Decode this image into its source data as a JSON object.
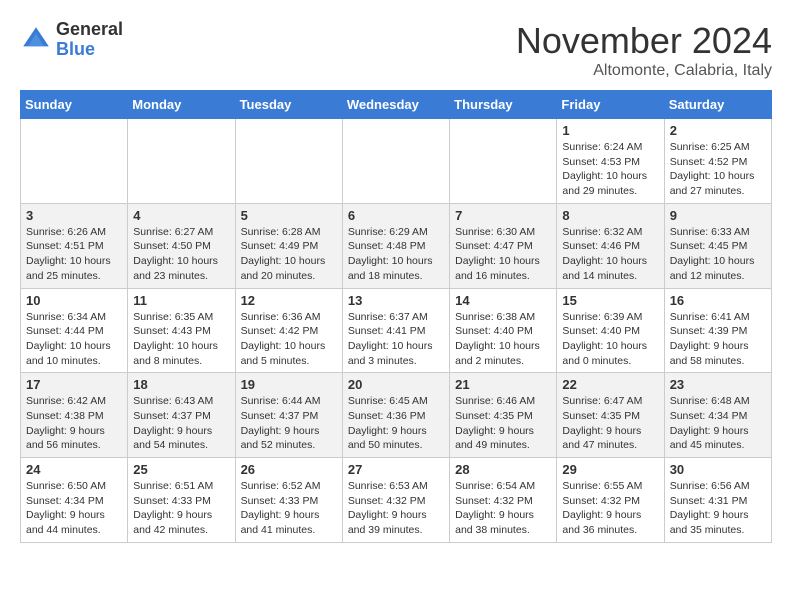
{
  "header": {
    "logo": {
      "line1": "General",
      "line2": "Blue"
    },
    "title": "November 2024",
    "subtitle": "Altomonte, Calabria, Italy"
  },
  "days_of_week": [
    "Sunday",
    "Monday",
    "Tuesday",
    "Wednesday",
    "Thursday",
    "Friday",
    "Saturday"
  ],
  "weeks": [
    [
      {
        "day": "",
        "info": ""
      },
      {
        "day": "",
        "info": ""
      },
      {
        "day": "",
        "info": ""
      },
      {
        "day": "",
        "info": ""
      },
      {
        "day": "",
        "info": ""
      },
      {
        "day": "1",
        "info": "Sunrise: 6:24 AM\nSunset: 4:53 PM\nDaylight: 10 hours and 29 minutes."
      },
      {
        "day": "2",
        "info": "Sunrise: 6:25 AM\nSunset: 4:52 PM\nDaylight: 10 hours and 27 minutes."
      }
    ],
    [
      {
        "day": "3",
        "info": "Sunrise: 6:26 AM\nSunset: 4:51 PM\nDaylight: 10 hours and 25 minutes."
      },
      {
        "day": "4",
        "info": "Sunrise: 6:27 AM\nSunset: 4:50 PM\nDaylight: 10 hours and 23 minutes."
      },
      {
        "day": "5",
        "info": "Sunrise: 6:28 AM\nSunset: 4:49 PM\nDaylight: 10 hours and 20 minutes."
      },
      {
        "day": "6",
        "info": "Sunrise: 6:29 AM\nSunset: 4:48 PM\nDaylight: 10 hours and 18 minutes."
      },
      {
        "day": "7",
        "info": "Sunrise: 6:30 AM\nSunset: 4:47 PM\nDaylight: 10 hours and 16 minutes."
      },
      {
        "day": "8",
        "info": "Sunrise: 6:32 AM\nSunset: 4:46 PM\nDaylight: 10 hours and 14 minutes."
      },
      {
        "day": "9",
        "info": "Sunrise: 6:33 AM\nSunset: 4:45 PM\nDaylight: 10 hours and 12 minutes."
      }
    ],
    [
      {
        "day": "10",
        "info": "Sunrise: 6:34 AM\nSunset: 4:44 PM\nDaylight: 10 hours and 10 minutes."
      },
      {
        "day": "11",
        "info": "Sunrise: 6:35 AM\nSunset: 4:43 PM\nDaylight: 10 hours and 8 minutes."
      },
      {
        "day": "12",
        "info": "Sunrise: 6:36 AM\nSunset: 4:42 PM\nDaylight: 10 hours and 5 minutes."
      },
      {
        "day": "13",
        "info": "Sunrise: 6:37 AM\nSunset: 4:41 PM\nDaylight: 10 hours and 3 minutes."
      },
      {
        "day": "14",
        "info": "Sunrise: 6:38 AM\nSunset: 4:40 PM\nDaylight: 10 hours and 2 minutes."
      },
      {
        "day": "15",
        "info": "Sunrise: 6:39 AM\nSunset: 4:40 PM\nDaylight: 10 hours and 0 minutes."
      },
      {
        "day": "16",
        "info": "Sunrise: 6:41 AM\nSunset: 4:39 PM\nDaylight: 9 hours and 58 minutes."
      }
    ],
    [
      {
        "day": "17",
        "info": "Sunrise: 6:42 AM\nSunset: 4:38 PM\nDaylight: 9 hours and 56 minutes."
      },
      {
        "day": "18",
        "info": "Sunrise: 6:43 AM\nSunset: 4:37 PM\nDaylight: 9 hours and 54 minutes."
      },
      {
        "day": "19",
        "info": "Sunrise: 6:44 AM\nSunset: 4:37 PM\nDaylight: 9 hours and 52 minutes."
      },
      {
        "day": "20",
        "info": "Sunrise: 6:45 AM\nSunset: 4:36 PM\nDaylight: 9 hours and 50 minutes."
      },
      {
        "day": "21",
        "info": "Sunrise: 6:46 AM\nSunset: 4:35 PM\nDaylight: 9 hours and 49 minutes."
      },
      {
        "day": "22",
        "info": "Sunrise: 6:47 AM\nSunset: 4:35 PM\nDaylight: 9 hours and 47 minutes."
      },
      {
        "day": "23",
        "info": "Sunrise: 6:48 AM\nSunset: 4:34 PM\nDaylight: 9 hours and 45 minutes."
      }
    ],
    [
      {
        "day": "24",
        "info": "Sunrise: 6:50 AM\nSunset: 4:34 PM\nDaylight: 9 hours and 44 minutes."
      },
      {
        "day": "25",
        "info": "Sunrise: 6:51 AM\nSunset: 4:33 PM\nDaylight: 9 hours and 42 minutes."
      },
      {
        "day": "26",
        "info": "Sunrise: 6:52 AM\nSunset: 4:33 PM\nDaylight: 9 hours and 41 minutes."
      },
      {
        "day": "27",
        "info": "Sunrise: 6:53 AM\nSunset: 4:32 PM\nDaylight: 9 hours and 39 minutes."
      },
      {
        "day": "28",
        "info": "Sunrise: 6:54 AM\nSunset: 4:32 PM\nDaylight: 9 hours and 38 minutes."
      },
      {
        "day": "29",
        "info": "Sunrise: 6:55 AM\nSunset: 4:32 PM\nDaylight: 9 hours and 36 minutes."
      },
      {
        "day": "30",
        "info": "Sunrise: 6:56 AM\nSunset: 4:31 PM\nDaylight: 9 hours and 35 minutes."
      }
    ]
  ]
}
